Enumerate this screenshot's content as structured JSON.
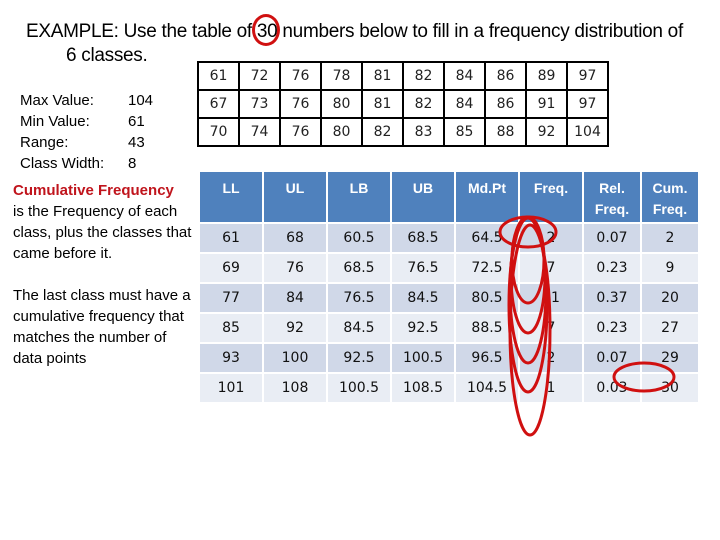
{
  "title": {
    "line1_pre": "EXAMPLE: Use the table of ",
    "highlight": "30",
    "line1_post": " numbers below to fill in a frequency distribution of",
    "line2": "6 classes."
  },
  "data_table": {
    "rows": [
      [
        "61",
        "72",
        "76",
        "78",
        "81",
        "82",
        "84",
        "86",
        "89",
        "97"
      ],
      [
        "67",
        "73",
        "76",
        "80",
        "81",
        "82",
        "84",
        "86",
        "91",
        "97"
      ],
      [
        "70",
        "74",
        "76",
        "80",
        "82",
        "83",
        "85",
        "88",
        "92",
        "104"
      ]
    ]
  },
  "stats": [
    {
      "label": "Max Value:",
      "value": "104"
    },
    {
      "label": "Min Value:",
      "value": "61"
    },
    {
      "label": "Range:",
      "value": "43"
    },
    {
      "label": "Class Width:",
      "value": "8"
    }
  ],
  "notes": {
    "term": "Cumulative Frequency",
    "definition": "is the Frequency of each class, plus the classes that came before it.",
    "rule": "The last class must have a cumulative frequency that matches the number of data points"
  },
  "freq_table": {
    "headers": [
      "LL",
      "UL",
      "LB",
      "UB",
      "Md.Pt",
      "Freq.",
      "Rel. Freq.",
      "Cum. Freq."
    ],
    "rows": [
      [
        "61",
        "68",
        "60.5",
        "68.5",
        "64.5",
        "2",
        "0.07",
        "2"
      ],
      [
        "69",
        "76",
        "68.5",
        "76.5",
        "72.5",
        "7",
        "0.23",
        "9"
      ],
      [
        "77",
        "84",
        "76.5",
        "84.5",
        "80.5",
        "11",
        "0.37",
        "20"
      ],
      [
        "85",
        "92",
        "84.5",
        "92.5",
        "88.5",
        "7",
        "0.23",
        "27"
      ],
      [
        "93",
        "100",
        "92.5",
        "100.5",
        "96.5",
        "2",
        "0.07",
        "29"
      ],
      [
        "101",
        "108",
        "100.5",
        "108.5",
        "104.5",
        "1",
        "0.03",
        "30"
      ]
    ]
  },
  "colors": {
    "header_bg": "#4f81bd",
    "row_odd": "#d0d8e8",
    "row_even": "#e9edf4",
    "annotation_red": "#d01010",
    "term_red": "#c0141c"
  }
}
